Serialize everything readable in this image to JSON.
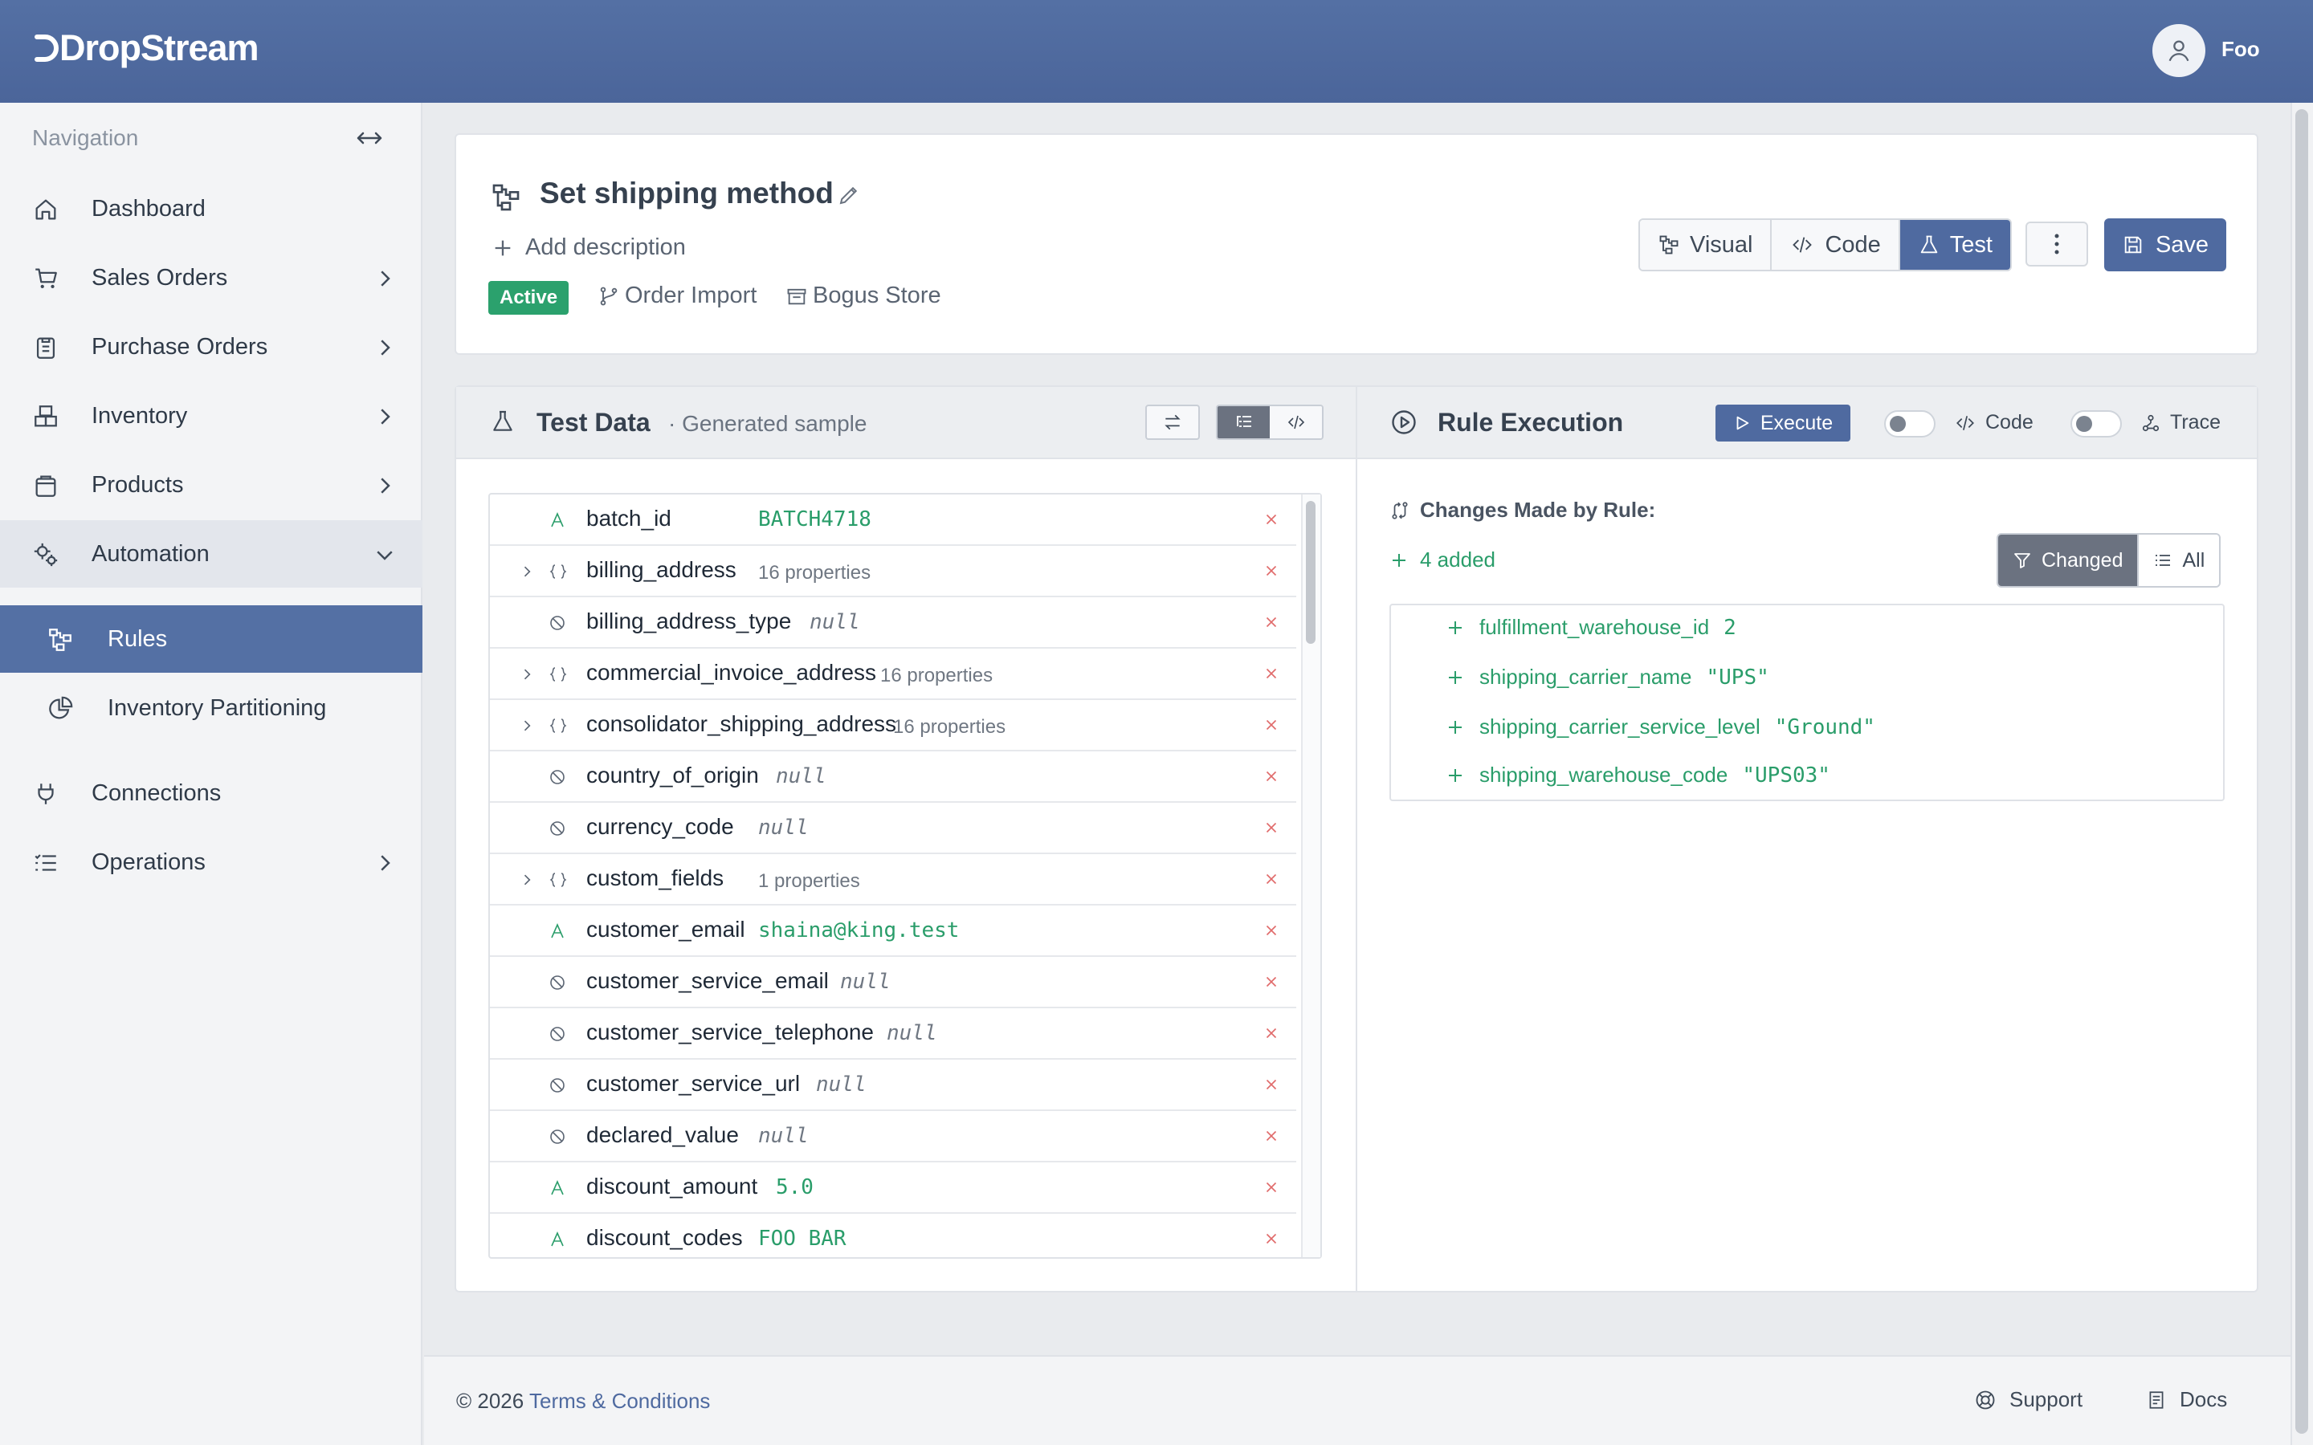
{
  "app": {
    "logo_text": "DropStream",
    "user_name": "Foo"
  },
  "nav": {
    "title": "Navigation",
    "items": [
      {
        "label": "Dashboard",
        "icon": "home-icon"
      },
      {
        "label": "Sales Orders",
        "icon": "cart-icon"
      },
      {
        "label": "Purchase Orders",
        "icon": "clipboard-icon"
      },
      {
        "label": "Inventory",
        "icon": "boxes-icon"
      },
      {
        "label": "Products",
        "icon": "bag-icon"
      },
      {
        "label": "Automation",
        "icon": "cogs-icon"
      },
      {
        "label": "Rules",
        "icon": "workflow-icon"
      },
      {
        "label": "Inventory Partitioning",
        "icon": "pie-icon"
      },
      {
        "label": "Connections",
        "icon": "plug-icon"
      },
      {
        "label": "Operations",
        "icon": "list-icon"
      }
    ]
  },
  "rule": {
    "title": "Set shipping method",
    "add_description": "Add description",
    "status": "Active",
    "meta": [
      "Order Import",
      "Bogus Store"
    ],
    "modes": [
      "Visual",
      "Code",
      "Test"
    ],
    "active_mode": "Test",
    "save_label": "Save"
  },
  "test_data": {
    "title": "Test Data",
    "subtitle": "· Generated sample",
    "rows": [
      {
        "key": "batch_id",
        "value": "BATCH4718",
        "type": "string"
      },
      {
        "key": "billing_address",
        "value": "16 properties",
        "type": "object"
      },
      {
        "key": "billing_address_type",
        "value": "null",
        "type": "null"
      },
      {
        "key": "commercial_invoice_address",
        "value": "16 properties",
        "type": "object"
      },
      {
        "key": "consolidator_shipping_address",
        "value": "16 properties",
        "type": "object"
      },
      {
        "key": "country_of_origin",
        "value": "null",
        "type": "null"
      },
      {
        "key": "currency_code",
        "value": "null",
        "type": "null"
      },
      {
        "key": "custom_fields",
        "value": "1 properties",
        "type": "object"
      },
      {
        "key": "customer_email",
        "value": "shaina@king.test",
        "type": "string"
      },
      {
        "key": "customer_service_email",
        "value": "null",
        "type": "null"
      },
      {
        "key": "customer_service_telephone",
        "value": "null",
        "type": "null"
      },
      {
        "key": "customer_service_url",
        "value": "null",
        "type": "null"
      },
      {
        "key": "declared_value",
        "value": "null",
        "type": "null"
      },
      {
        "key": "discount_amount",
        "value": "5.0",
        "type": "string"
      },
      {
        "key": "discount_codes",
        "value": "FOO BAR",
        "type": "string"
      }
    ]
  },
  "execution": {
    "title": "Rule Execution",
    "execute_label": "Execute",
    "code_toggle_label": "Code",
    "trace_toggle_label": "Trace",
    "changes_title": "Changes Made by Rule:",
    "added_summary": "4 added",
    "filters": [
      "Changed",
      "All"
    ],
    "changes": [
      {
        "key": "fulfillment_warehouse_id",
        "value": "2"
      },
      {
        "key": "shipping_carrier_name",
        "value": "\"UPS\""
      },
      {
        "key": "shipping_carrier_service_level",
        "value": "\"Ground\""
      },
      {
        "key": "shipping_warehouse_code",
        "value": "\"UPS03\""
      }
    ]
  },
  "footer": {
    "copyright": "© 2026",
    "terms": "Terms & Conditions",
    "support": "Support",
    "docs": "Docs"
  },
  "colors": {
    "brand": "#4f6aa0",
    "success": "#2a9d6a",
    "danger": "#e06b6b"
  }
}
